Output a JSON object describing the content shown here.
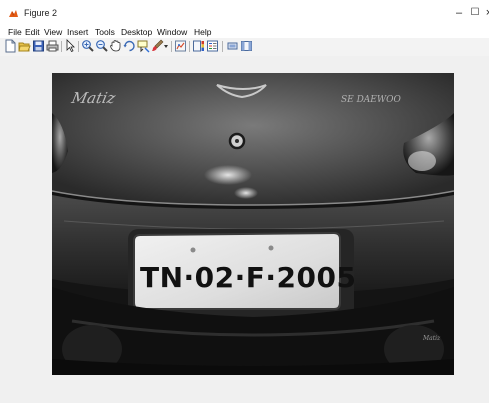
{
  "window": {
    "title": "Figure 2",
    "controls": {
      "minimize": "–",
      "maximize": "☐",
      "close": "×"
    }
  },
  "menu": {
    "items": [
      {
        "label": "File"
      },
      {
        "label": "Edit"
      },
      {
        "label": "View"
      },
      {
        "label": "Insert"
      },
      {
        "label": "Tools"
      },
      {
        "label": "Desktop"
      },
      {
        "label": "Window"
      },
      {
        "label": "Help"
      }
    ]
  },
  "toolbar": {
    "icons": [
      "new-figure-icon",
      "open-file-icon",
      "save-icon",
      "print-icon",
      "edit-plot-arrow-icon",
      "zoom-in-icon",
      "zoom-out-icon",
      "pan-icon",
      "rotate-3d-icon",
      "data-cursor-icon",
      "brush-icon",
      "link-plot-icon",
      "insert-colorbar-icon",
      "insert-legend-icon",
      "hide-plot-tools-icon",
      "show-plot-tools-icon"
    ]
  },
  "image": {
    "description_kind": "grayscale photograph of car rear with license plate",
    "plate_text": "TN·02·F·2005",
    "badge_left": "Matiz",
    "badge_right": "SE DAEWOO",
    "badge_small": "Matiz"
  },
  "colors": {
    "window_bg": "#ffffff",
    "toolbar_bg": "#f3f3f3",
    "figure_bg": "#f0f0f0",
    "image_dark": "#1a1a1a",
    "plate_bg": "#e9e9e9",
    "plate_text": "#111111"
  }
}
